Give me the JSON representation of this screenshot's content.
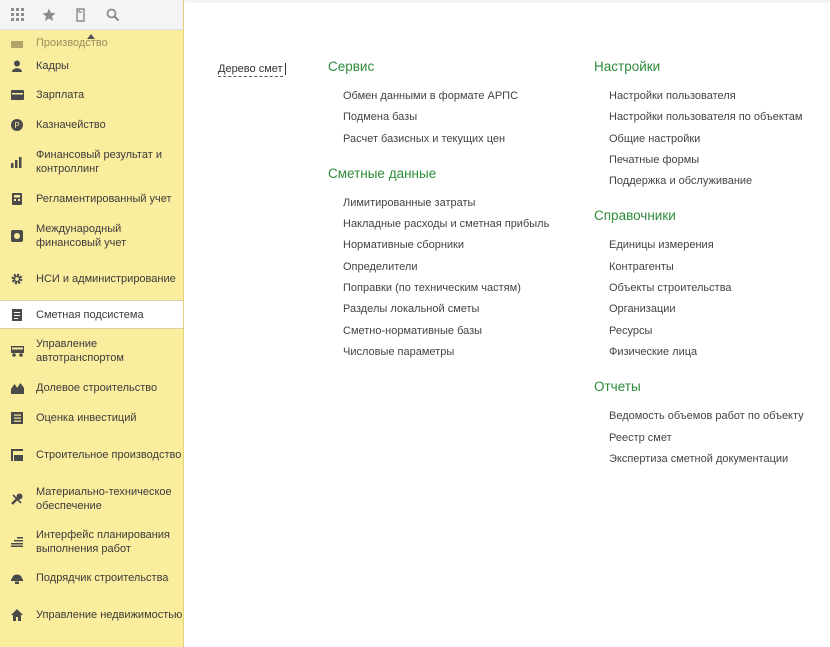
{
  "topbar": {
    "icons": [
      "apps-grid-icon",
      "star-icon",
      "history-icon",
      "search-icon"
    ]
  },
  "sidebar": {
    "items": [
      {
        "label": "Производство",
        "icon": "factory-icon",
        "faded": true
      },
      {
        "label": "Кадры",
        "icon": "person-icon"
      },
      {
        "label": "Зарплата",
        "icon": "wallet-icon"
      },
      {
        "label": "Казначейство",
        "icon": "coin-icon"
      },
      {
        "label": "Финансовый результат и контроллинг",
        "icon": "bar-chart-icon"
      },
      {
        "label": "Регламентированный учет",
        "icon": "calculator-icon"
      },
      {
        "label": "Международный финансовый учет",
        "icon": "globe-icon"
      },
      {
        "label": "НСИ и администрирование",
        "icon": "gear-icon"
      },
      {
        "label": "Сметная подсистема",
        "icon": "document-icon",
        "active": true
      },
      {
        "label": "Управление автотранспортом",
        "icon": "truck-icon"
      },
      {
        "label": "Долевое строительство",
        "icon": "houses-icon"
      },
      {
        "label": "Оценка инвестиций",
        "icon": "ledger-icon"
      },
      {
        "label": "Строительное производство",
        "icon": "crane-icon"
      },
      {
        "label": "Материально-техническое обеспечение",
        "icon": "tools-icon"
      },
      {
        "label": "Интерфейс планирования выполнения работ",
        "icon": "gantt-icon"
      },
      {
        "label": "Подрядчик строительства",
        "icon": "helmet-icon"
      },
      {
        "label": "Управление недвижимостью",
        "icon": "home-icon"
      }
    ]
  },
  "main": {
    "tree_link": "Дерево смет",
    "columns": [
      {
        "sections": [
          {
            "title": "Сервис",
            "items": [
              "Обмен данными в формате АРПС",
              "Подмена базы",
              "Расчет базисных и текущих цен"
            ]
          },
          {
            "title": "Сметные данные",
            "items": [
              "Лимитированные затраты",
              "Накладные расходы и сметная прибыль",
              "Нормативные сборники",
              "Определители",
              "Поправки (по техническим частям)",
              "Разделы локальной сметы",
              "Сметно-нормативные базы",
              "Числовые параметры"
            ]
          }
        ]
      },
      {
        "sections": [
          {
            "title": "Настройки",
            "items": [
              "Настройки пользователя",
              "Настройки пользователя по объектам",
              "Общие настройки",
              "Печатные формы",
              "Поддержка и обслуживание"
            ]
          },
          {
            "title": "Справочники",
            "items": [
              "Единицы измерения",
              "Контрагенты",
              "Объекты строительства",
              "Организации",
              "Ресурсы",
              "Физические лица"
            ]
          },
          {
            "title": "Отчеты",
            "items": [
              "Ведомость объемов работ по объекту",
              "Реестр смет",
              "Экспертиза сметной документации"
            ]
          }
        ]
      }
    ]
  }
}
